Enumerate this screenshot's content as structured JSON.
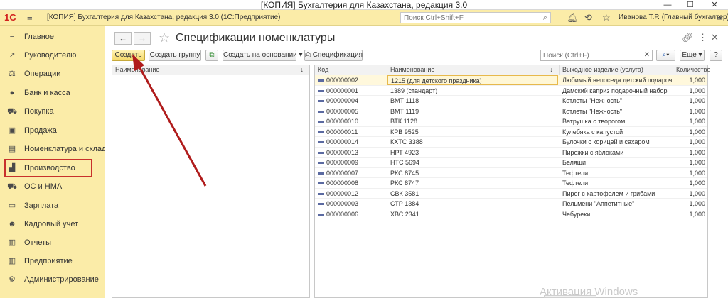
{
  "window": {
    "title": "[КОПИЯ] Бухгалтерия для Казахстана, редакция 3.0",
    "minimize": "—",
    "maximize": "☐",
    "close": "✕"
  },
  "app_header": {
    "logo": "1С",
    "app_title": "[КОПИЯ] Бухгалтерия для Казахстана, редакция 3.0  (1С:Предприятие)",
    "search_placeholder": "Поиск Ctrl+Shift+F",
    "user": "Иванова Т.Р. (Главный бухгалтер)"
  },
  "sidebar": {
    "items": [
      {
        "label": "Главное",
        "icon": "menu-icon",
        "glyph": "≡"
      },
      {
        "label": "Руководителю",
        "icon": "chart-icon",
        "glyph": "↗"
      },
      {
        "label": "Операции",
        "icon": "scales-icon",
        "glyph": "⚖"
      },
      {
        "label": "Банк и касса",
        "icon": "coin-icon",
        "glyph": "●"
      },
      {
        "label": "Покупка",
        "icon": "cart-icon",
        "glyph": "⛟"
      },
      {
        "label": "Продажа",
        "icon": "bag-icon",
        "glyph": "▣"
      },
      {
        "label": "Номенклатура и склад",
        "icon": "warehouse-icon",
        "glyph": "▤"
      },
      {
        "label": "Производство",
        "icon": "factory-icon",
        "glyph": "▟"
      },
      {
        "label": "ОС и НМА",
        "icon": "truck-icon",
        "glyph": "⛟"
      },
      {
        "label": "Зарплата",
        "icon": "wallet-icon",
        "glyph": "▭"
      },
      {
        "label": "Кадровый учет",
        "icon": "people-icon",
        "glyph": "☻"
      },
      {
        "label": "Отчеты",
        "icon": "report-icon",
        "glyph": "▥"
      },
      {
        "label": "Предприятие",
        "icon": "enterprise-icon",
        "glyph": "▥"
      },
      {
        "label": "Администрирование",
        "icon": "gear-icon",
        "glyph": "⚙"
      }
    ]
  },
  "page": {
    "back": "←",
    "forward": "→",
    "title": "Спецификации номенклатуры"
  },
  "toolbar": {
    "create": "Создать",
    "create_group": "Создать группу",
    "create_based_on": "Создать на основании",
    "specification": "Спецификация",
    "search_placeholder": "Поиск (Ctrl+F)",
    "more": "Еще"
  },
  "left_panel": {
    "header": "Наименование"
  },
  "table": {
    "columns": [
      "Код",
      "Наименование",
      "Выходное изделие (услуга)",
      "Количество"
    ],
    "rows": [
      {
        "code": "000000002",
        "name": "1215 (для детского праздника)",
        "product": "Любимый непоседа детский подароч...",
        "qty": "1,000"
      },
      {
        "code": "000000001",
        "name": "1389 (стандарт)",
        "product": "Дамский каприз подарочный набор",
        "qty": "1,000"
      },
      {
        "code": "000000004",
        "name": "ВМТ 1118",
        "product": "Котлеты \"Нежность\"",
        "qty": "1,000"
      },
      {
        "code": "000000005",
        "name": "ВМТ 1119",
        "product": "Котлеты \"Нежность\"",
        "qty": "1,000"
      },
      {
        "code": "000000010",
        "name": "ВТК 1128",
        "product": "Ватрушка с творогом",
        "qty": "1,000"
      },
      {
        "code": "000000011",
        "name": "КРВ 9525",
        "product": "Кулебяка с капустой",
        "qty": "1,000"
      },
      {
        "code": "000000014",
        "name": "КХТС 3388",
        "product": "Булочки с корицей и сахаром",
        "qty": "1,000"
      },
      {
        "code": "000000013",
        "name": "НРТ 4923",
        "product": "Пирожки с яблоками",
        "qty": "1,000"
      },
      {
        "code": "000000009",
        "name": "НТС 5694",
        "product": "Беляши",
        "qty": "1,000"
      },
      {
        "code": "000000007",
        "name": "РКС 8745",
        "product": "Тефтели",
        "qty": "1,000"
      },
      {
        "code": "000000008",
        "name": "РКС 8747",
        "product": "Тефтели",
        "qty": "1,000"
      },
      {
        "code": "000000012",
        "name": "СВК 3581",
        "product": "Пирог с картофелем и грибами",
        "qty": "1,000"
      },
      {
        "code": "000000003",
        "name": "СТР 1384",
        "product": "Пельмени \"Аппетитные\"",
        "qty": "1,000"
      },
      {
        "code": "000000006",
        "name": "ХВС 2341",
        "product": "Чебуреки",
        "qty": "1,000"
      }
    ]
  },
  "overlay": {
    "watermark": "Активация Windows",
    "arrow_color": "#b01c1c",
    "highlight_color": "#c8312c"
  }
}
